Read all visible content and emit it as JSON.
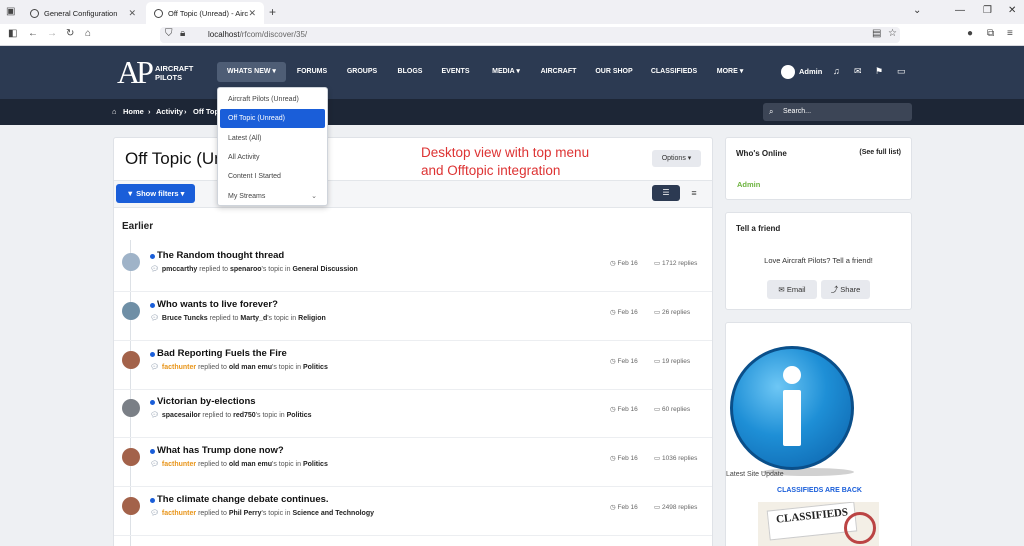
{
  "browser": {
    "tabs": [
      {
        "label": "General Configuration"
      },
      {
        "label": "Off Topic (Unread) - Aircraft Pilo"
      }
    ],
    "url_host": "localhost",
    "url_path": "/rfcom/discover/35/"
  },
  "header": {
    "logo_mark": "AP",
    "logo_line1": "AIRCRAFT",
    "logo_line2": "PILOTS",
    "nav": [
      "WHATS NEW",
      "FORUMS",
      "GROUPS",
      "BLOGS",
      "EVENTS",
      "MEDIA",
      "AIRCRAFT",
      "OUR SHOP",
      "CLASSIFIEDS",
      "MORE"
    ],
    "user": "Admin"
  },
  "breadcrumb": [
    "Home",
    "Activity",
    "Off Topi"
  ],
  "search": {
    "placeholder": "Search..."
  },
  "dropdown": {
    "items": [
      "Aircraft Pilots (Unread)",
      "Off Topic (Unread)",
      "Latest (All)",
      "All Activity",
      "Content I Started",
      "My Streams"
    ],
    "selected_index": 1
  },
  "page": {
    "title": "Off Topic (Un",
    "options_label": "Options",
    "show_filters_label": "Show filters",
    "section_label": "Earlier"
  },
  "note": {
    "line1": "Desktop view with top menu",
    "line2": "and Offtopic integration"
  },
  "threads": [
    {
      "title": "The Random thought thread",
      "user": "pmccarthy",
      "action": "replied to",
      "target": "spenaroo",
      "suffix": "'s topic in",
      "forum": "General Discussion",
      "date": "Feb 16",
      "replies": "1712 replies",
      "highlight": false
    },
    {
      "title": "Who wants to live forever?",
      "user": "Bruce Tuncks",
      "action": "replied to",
      "target": "Marty_d",
      "suffix": "'s topic in",
      "forum": "Religion",
      "date": "Feb 16",
      "replies": "26 replies",
      "highlight": false
    },
    {
      "title": "Bad Reporting Fuels the Fire",
      "user": "facthunter",
      "action": "replied to",
      "target": "old man emu",
      "suffix": "'s topic in",
      "forum": "Politics",
      "date": "Feb 16",
      "replies": "19 replies",
      "highlight": true
    },
    {
      "title": "Victorian by-elections",
      "user": "spacesailor",
      "action": "replied to",
      "target": "red750",
      "suffix": "'s topic in",
      "forum": "Politics",
      "date": "Feb 16",
      "replies": "60 replies",
      "highlight": false
    },
    {
      "title": "What has Trump done now?",
      "user": "facthunter",
      "action": "replied to",
      "target": "old man emu",
      "suffix": "'s topic in",
      "forum": "Politics",
      "date": "Feb 16",
      "replies": "1036 replies",
      "highlight": true
    },
    {
      "title": "The climate change debate continues.",
      "user": "facthunter",
      "action": "replied to",
      "target": "Phil Perry",
      "suffix": "'s topic in",
      "forum": "Science and Technology",
      "date": "Feb 16",
      "replies": "2498 replies",
      "highlight": true
    }
  ],
  "sidebar": {
    "online_title": "Who's Online",
    "see_full": "(See full list)",
    "online_user": "Admin",
    "tell_title": "Tell a friend",
    "tell_text": "Love Aircraft Pilots? Tell a friend!",
    "email_label": "Email",
    "share_label": "Share",
    "site_update": "Latest Site Update",
    "classifieds_title": "CLASSIFIEDS ARE BACK",
    "classifieds_word": "CLASSIFIEDS"
  }
}
